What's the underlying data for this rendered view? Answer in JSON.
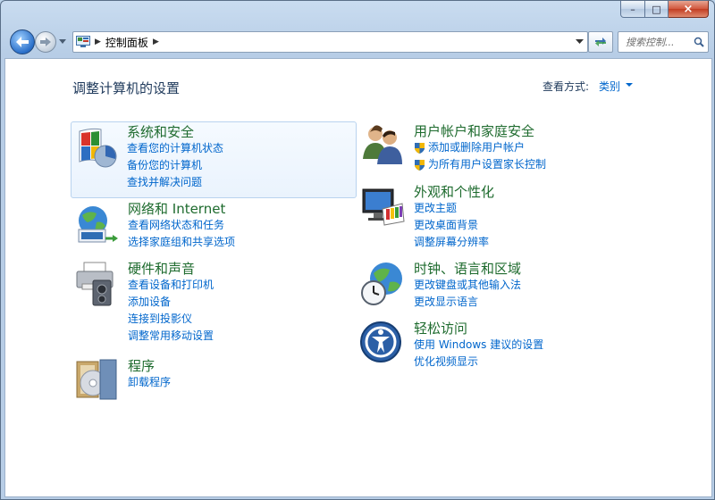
{
  "window": {
    "caption": {
      "minimize": "–",
      "maximize": "□",
      "close": "×"
    }
  },
  "nav": {
    "breadcrumb": "控制面板",
    "search_placeholder": "搜索控制..."
  },
  "main": {
    "title": "调整计算机的设置",
    "view_by_label": "查看方式:",
    "view_by_value": "类别"
  },
  "categories": [
    {
      "title": "系统和安全",
      "icon": "shield-icon",
      "links": [
        "查看您的计算机状态",
        "备份您的计算机",
        "查找并解决问题"
      ]
    },
    {
      "title": "网络和 Internet",
      "icon": "network-globe-icon",
      "links": [
        "查看网络状态和任务",
        "选择家庭组和共享选项"
      ]
    },
    {
      "title": "硬件和声音",
      "icon": "printer-speaker-icon",
      "links": [
        "查看设备和打印机",
        "添加设备",
        "连接到投影仪",
        "调整常用移动设置"
      ]
    },
    {
      "title": "程序",
      "icon": "programs-icon",
      "links": [
        "卸载程序"
      ]
    },
    {
      "title": "用户帐户和家庭安全",
      "icon": "users-icon",
      "links": [
        "添加或删除用户帐户",
        "为所有用户设置家长控制"
      ]
    },
    {
      "title": "外观和个性化",
      "icon": "monitor-palette-icon",
      "links": [
        "更改主题",
        "更改桌面背景",
        "调整屏幕分辨率"
      ]
    },
    {
      "title": "时钟、语言和区域",
      "icon": "clock-globe-icon",
      "links": [
        "更改键盘或其他输入法",
        "更改显示语言"
      ]
    },
    {
      "title": "轻松访问",
      "icon": "ease-of-access-icon",
      "links": [
        "使用 Windows 建议的设置",
        "优化视频显示"
      ]
    }
  ],
  "colors": {
    "category_title": "#1e6b2e",
    "link": "#0066cc",
    "heading": "#1e395b"
  }
}
